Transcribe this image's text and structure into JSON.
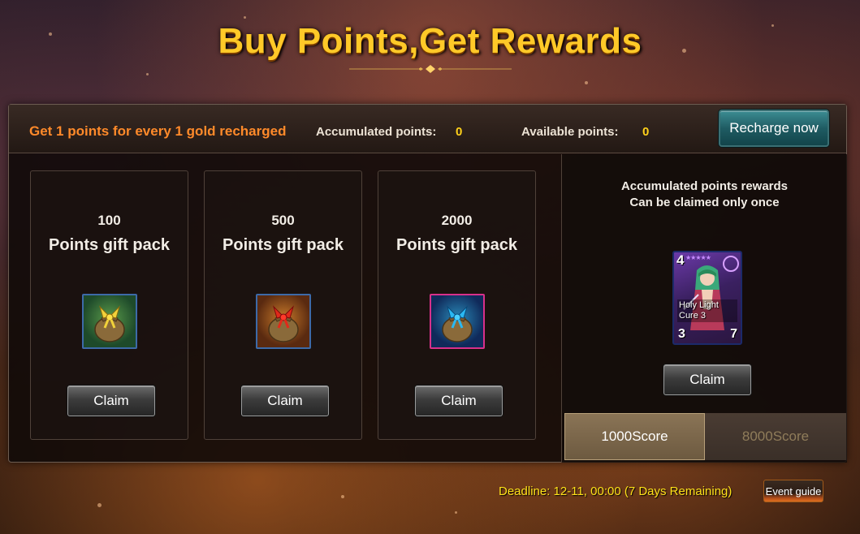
{
  "header": {
    "title": "Buy Points,Get Rewards"
  },
  "topbar": {
    "intro": "Get 1 points for every 1 gold recharged",
    "accumulated_label": "Accumulated points:",
    "accumulated_value": "0",
    "available_label": "Available points:",
    "available_value": "0",
    "recharge_label": "Recharge now"
  },
  "packs": [
    {
      "amount": "100",
      "name": "Points gift pack",
      "claim_label": "Claim",
      "icon": "gift-bag-yellow-ribbon-icon"
    },
    {
      "amount": "500",
      "name": "Points gift pack",
      "claim_label": "Claim",
      "icon": "gift-bag-red-ribbon-icon"
    },
    {
      "amount": "2000",
      "name": "Points gift pack",
      "claim_label": "Claim",
      "icon": "gift-bag-blue-ribbon-icon"
    }
  ],
  "rewards": {
    "heading_line1": "Accumulated points rewards",
    "heading_line2": "Can be claimed only once",
    "card": {
      "level": "4",
      "name_line1": "Holy Light",
      "name_line2": "Cure 3",
      "attack": "3",
      "hp": "7"
    },
    "claim_label": "Claim",
    "tabs": [
      {
        "label": "1000Score",
        "active": true
      },
      {
        "label": "8000Score",
        "active": false
      }
    ]
  },
  "footer": {
    "deadline": "Deadline: 12-11, 00:00 (7 Days Remaining)",
    "guide_label": "Event guide"
  },
  "colors": {
    "title": "#ffc928",
    "intro": "#ff8a2a",
    "points_value": "#ffd11a",
    "deadline": "#ffe11a"
  }
}
